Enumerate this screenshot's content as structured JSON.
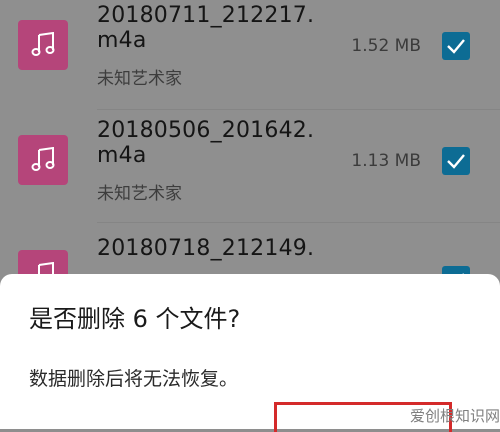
{
  "files": [
    {
      "name": "20180711_212217.m4a",
      "artist": "未知艺术家",
      "size": "1.52 MB",
      "checked": true
    },
    {
      "name": "20180506_201642.m4a",
      "artist": "未知艺术家",
      "size": "1.13 MB",
      "checked": true
    },
    {
      "name": "20180718_212149.",
      "artist": "",
      "size": "",
      "checked": true
    }
  ],
  "dialog": {
    "title": "是否删除 6 个文件?",
    "message": "数据删除后将无法恢复。"
  },
  "watermark": "爱创根知识网",
  "colors": {
    "thumb": "#b5457a",
    "checkbox": "#0d6c94",
    "highlight": "#d42a2a"
  },
  "icons": {
    "thumb": "music-note-icon",
    "check": "check-icon"
  }
}
